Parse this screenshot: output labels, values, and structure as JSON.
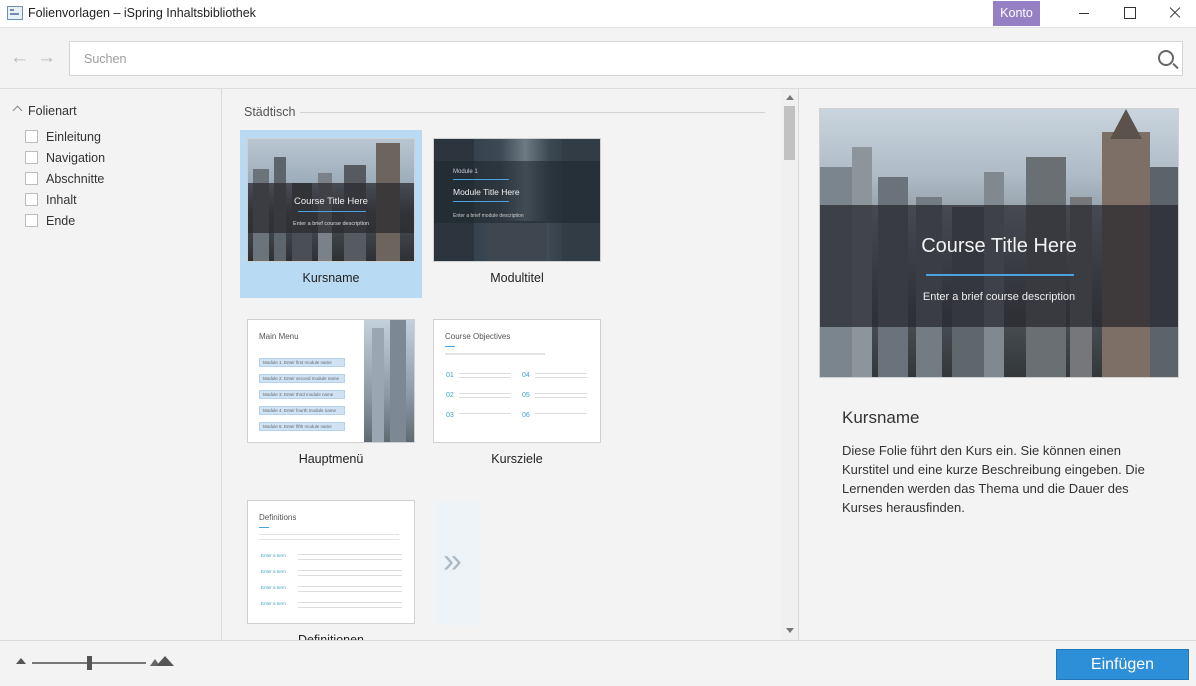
{
  "window": {
    "title": "Folienvorlagen – iSpring Inhaltsbibliothek",
    "account_label": "Konto"
  },
  "search": {
    "placeholder": "Suchen",
    "value": ""
  },
  "filters": {
    "heading": "Folienart",
    "items": [
      {
        "label": "Einleitung",
        "checked": false
      },
      {
        "label": "Navigation",
        "checked": false
      },
      {
        "label": "Abschnitte",
        "checked": false
      },
      {
        "label": "Inhalt",
        "checked": false
      },
      {
        "label": "Ende",
        "checked": false
      }
    ]
  },
  "gallery": {
    "section_label": "Städtisch",
    "tiles": [
      {
        "label": "Kursname",
        "selected": true
      },
      {
        "label": "Modultitel",
        "selected": false
      },
      {
        "label": "Hauptmenü",
        "selected": false
      },
      {
        "label": "Kursziele",
        "selected": false
      },
      {
        "label": "Definitionen",
        "selected": false
      }
    ],
    "thumbs": {
      "course": {
        "title": "Course Title Here",
        "sub": "Enter a brief course description"
      },
      "module": {
        "kicker": "Module 1",
        "title": "Module Title Here",
        "sub": "Enter a brief module description"
      },
      "menu": {
        "title": "Main Menu",
        "rows": [
          "Module 1. Enter first module name",
          "Module 2. Enter second module name",
          "Module 3. Enter third module name",
          "Module 4. Enter fourth module name",
          "Module 5. Enter fifth module name"
        ]
      },
      "objectives": {
        "title": "Course Objectives",
        "nums": [
          "01",
          "02",
          "03",
          "04",
          "05",
          "06"
        ]
      },
      "definitions": {
        "title": "Definitions",
        "terms": [
          "Enter a term",
          "Enter a term",
          "Enter a term",
          "Enter a term"
        ]
      }
    }
  },
  "preview": {
    "title": "Course Title Here",
    "subtitle": "Enter a brief course description",
    "name": "Kursname",
    "description": "Diese Folie führt den Kurs ein. Sie können einen Kurstitel und eine kurze Beschreibung eingeben. Die Lernenden werden das Thema und die Dauer des Kurses herausfinden."
  },
  "zoom": {
    "level": 0.5
  },
  "actions": {
    "insert_label": "Einfügen"
  }
}
